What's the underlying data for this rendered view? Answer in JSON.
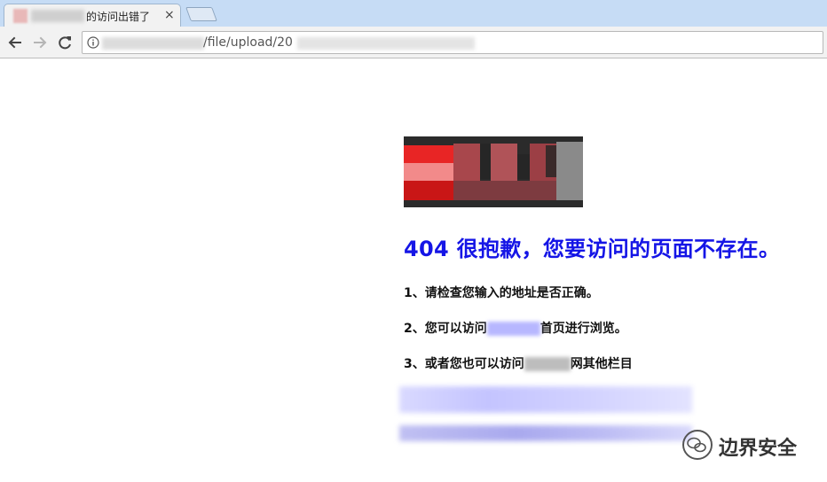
{
  "browser": {
    "tab": {
      "title": "的访问出错了",
      "close_glyph": "×"
    },
    "address_bar": {
      "url_visible": "/file/upload/20"
    },
    "icons": [
      "back-icon",
      "forward-icon",
      "reload-icon",
      "info-icon",
      "tab-close-icon"
    ]
  },
  "page": {
    "heading": "404 很抱歉，您要访问的页面不存在。",
    "lines": {
      "l1": "1、请检查您输入的地址是否正确。",
      "l2_prefix": "2、您可以访问",
      "l2_suffix": "首页进行浏览。",
      "l3_prefix": "3、或者您也可以访问",
      "l3_suffix": "网其他栏目"
    },
    "colors": {
      "heading": "#1515e6",
      "redaction": "#b7b7ff"
    }
  },
  "watermark": {
    "text": "边界安全",
    "icon": "wechat-icon"
  }
}
